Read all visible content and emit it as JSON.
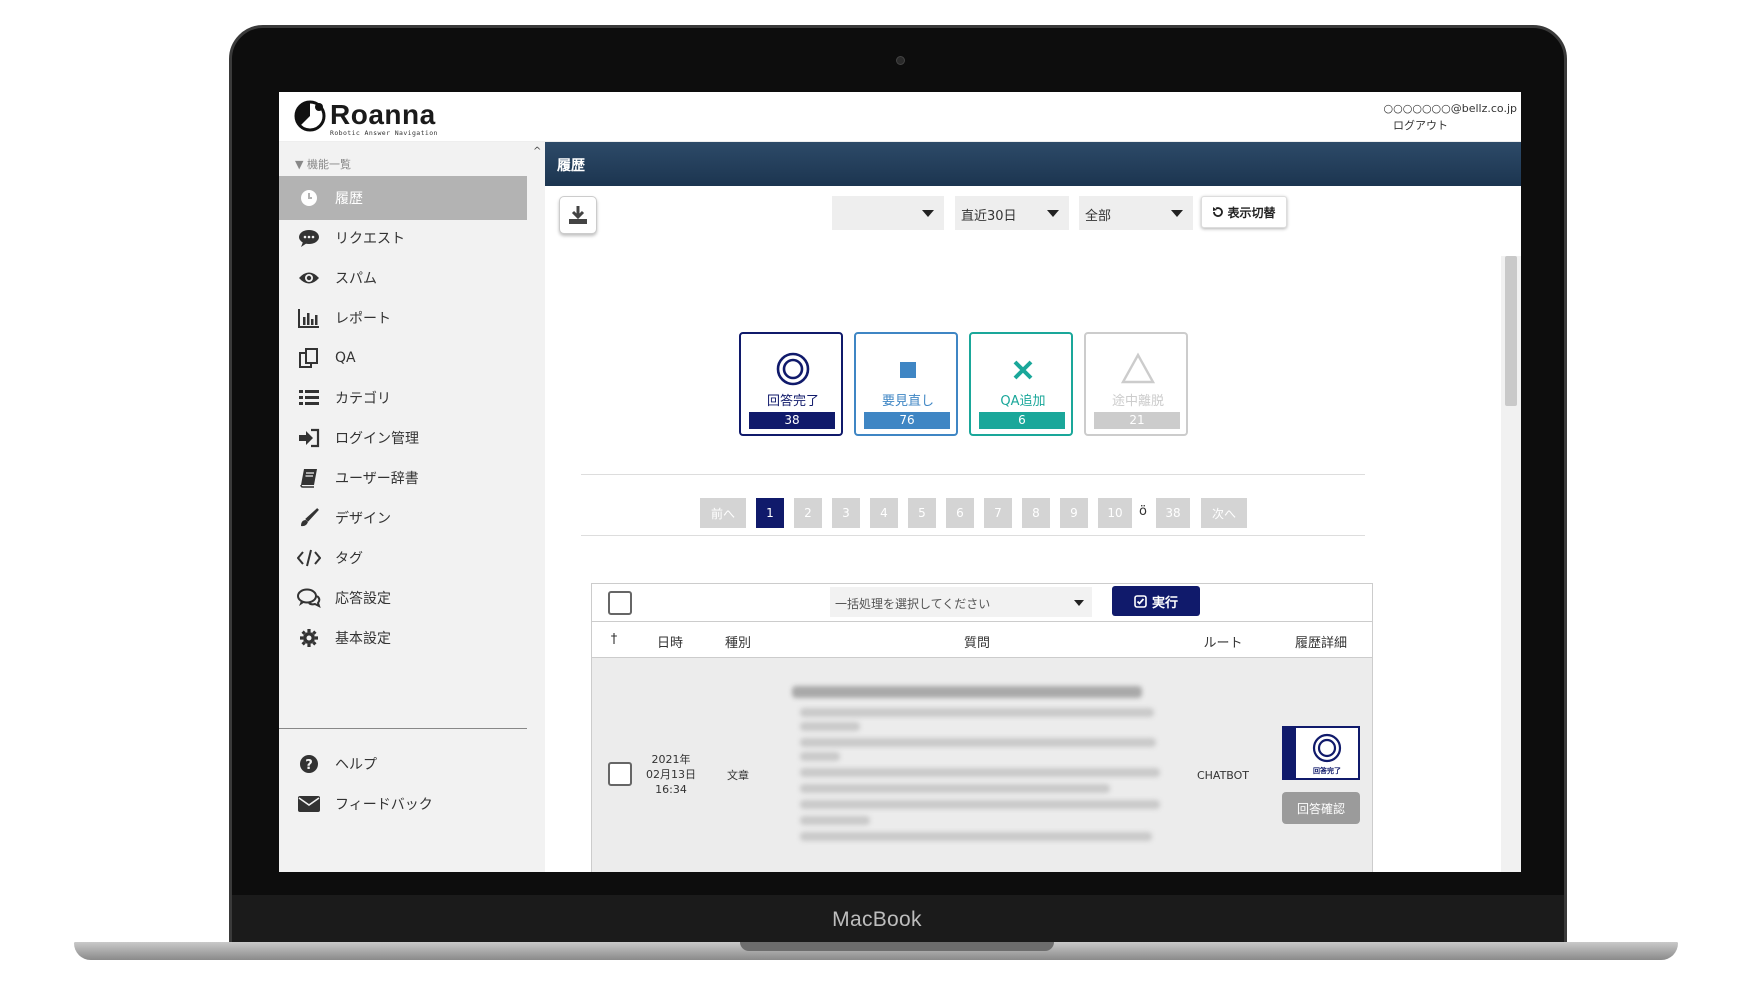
{
  "device": {
    "brand": "MacBook"
  },
  "app": {
    "logo_text": "Roanna",
    "logo_subtitle": "Robotic Answer Navigation",
    "user_email": "○○○○○○○@bellz.co.jp",
    "logout_label": "ログアウト"
  },
  "sidebar": {
    "heading": "▼ 機能一覧",
    "items": [
      {
        "label": "履歴",
        "icon": "clock-icon"
      },
      {
        "label": "リクエスト",
        "icon": "speech-bubble-icon"
      },
      {
        "label": "スパム",
        "icon": "eye-icon"
      },
      {
        "label": "レポート",
        "icon": "bar-chart-icon"
      },
      {
        "label": "QA",
        "icon": "clipboard-icon"
      },
      {
        "label": "カテゴリ",
        "icon": "list-icon"
      },
      {
        "label": "ログイン管理",
        "icon": "sign-in-icon"
      },
      {
        "label": "ユーザー辞書",
        "icon": "book-icon"
      },
      {
        "label": "デザイン",
        "icon": "brush-icon"
      },
      {
        "label": "タグ",
        "icon": "code-icon"
      },
      {
        "label": "応答設定",
        "icon": "comments-icon"
      },
      {
        "label": "基本設定",
        "icon": "gear-icon"
      }
    ],
    "footer_items": [
      {
        "label": "ヘルプ",
        "icon": "question-icon"
      },
      {
        "label": "フィードバック",
        "icon": "envelope-icon"
      }
    ]
  },
  "main": {
    "title": "履歴",
    "filters": [
      {
        "value": ""
      },
      {
        "value": "直近30日"
      },
      {
        "value": "全部"
      }
    ],
    "toggle_label": "表示切替",
    "status_cards": [
      {
        "label": "回答完了",
        "count": "38",
        "color": "#101a6b",
        "symbol": "double-circle-icon"
      },
      {
        "label": "要見直し",
        "count": "76",
        "color": "#3f86c4",
        "symbol": "square-icon"
      },
      {
        "label": "QA追加",
        "count": "6",
        "color": "#1aa79a",
        "symbol": "cross-icon"
      },
      {
        "label": "途中離脱",
        "count": "21",
        "color": "#cccccc",
        "symbol": "triangle-icon"
      }
    ],
    "pagination": {
      "prev": "前へ",
      "pages": [
        "1",
        "2",
        "3",
        "4",
        "5",
        "6",
        "7",
        "8",
        "9",
        "10"
      ],
      "ellipsis": "ö",
      "last": "38",
      "next": "次へ"
    },
    "bulk": {
      "placeholder": "一括処理を選択してください",
      "run_label": "実行"
    },
    "table": {
      "columns": [
        "†",
        "日時",
        "種別",
        "質問",
        "ルート",
        "履歴詳細"
      ],
      "rows": [
        {
          "date_year": "2021年",
          "date_day": "02月13日",
          "date_time": "16:34",
          "type": "文章",
          "route": "CHATBOT",
          "detail_label": "回答完了",
          "confirm_label": "回答確認"
        }
      ]
    }
  }
}
